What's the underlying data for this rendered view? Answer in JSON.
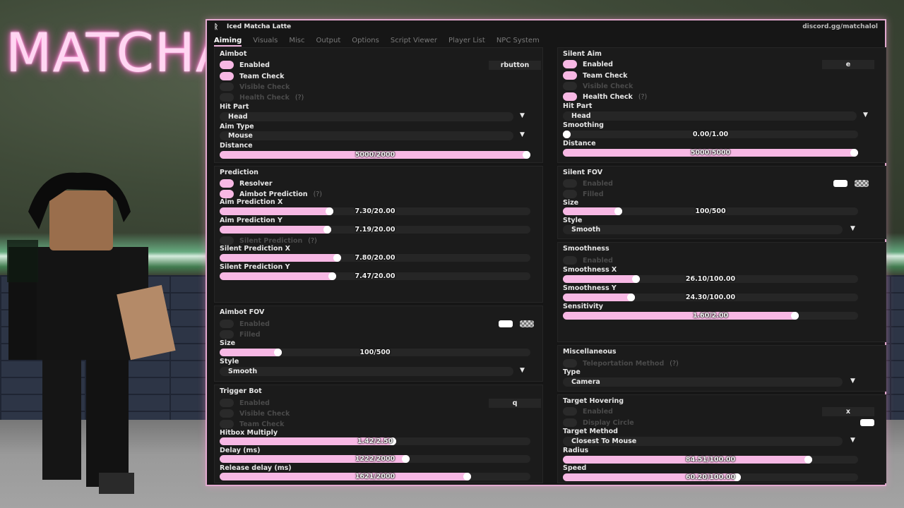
{
  "logo_text": "MATCHA",
  "window": {
    "icon": "matcha-icon",
    "title": "Iced Matcha Latte",
    "discord": "discord.gg/matchalol"
  },
  "tabs": [
    "Aiming",
    "Visuals",
    "Misc",
    "Output",
    "Options",
    "Script Viewer",
    "Player List",
    "NPC System"
  ],
  "active_tab": "Aiming",
  "accent_color": "#f7b8e4",
  "aimbot": {
    "title": "Aimbot",
    "enabled": {
      "label": "Enabled",
      "on": true
    },
    "team_check": {
      "label": "Team Check",
      "on": true
    },
    "visible_check": {
      "label": "Visible Check",
      "on": false
    },
    "health_check": {
      "label": "Health Check",
      "on": false,
      "help": "(?)"
    },
    "keybind": "rbutton",
    "hit_part": {
      "label": "Hit Part",
      "value": "Head"
    },
    "aim_type": {
      "label": "Aim Type",
      "value": "Mouse"
    },
    "distance": {
      "label": "Distance",
      "value": "5000/2000",
      "fraction": 1.0
    }
  },
  "prediction": {
    "title": "Prediction",
    "resolver": {
      "label": "Resolver",
      "on": true
    },
    "aimbot_prediction": {
      "label": "Aimbot Prediction",
      "on": true,
      "help": "(?)"
    },
    "aim_x": {
      "label": "Aim Prediction X",
      "value": "7.30/20.00",
      "fraction": 0.365
    },
    "aim_y": {
      "label": "Aim Prediction Y",
      "value": "7.19/20.00",
      "fraction": 0.36
    },
    "silent_prediction": {
      "label": "Silent Prediction",
      "on": false,
      "help": "(?)"
    },
    "silent_x": {
      "label": "Silent Prediction X",
      "value": "7.80/20.00",
      "fraction": 0.39
    },
    "silent_y": {
      "label": "Silent Prediction Y",
      "value": "7.47/20.00",
      "fraction": 0.374
    }
  },
  "aimbot_fov": {
    "title": "Aimbot FOV",
    "enabled": {
      "label": "Enabled",
      "on": false
    },
    "filled": {
      "label": "Filled",
      "on": false
    },
    "size": {
      "label": "Size",
      "value": "100/500",
      "fraction": 0.2
    },
    "style": {
      "label": "Style",
      "value": "Smooth"
    }
  },
  "trigger_bot": {
    "title": "Trigger Bot",
    "enabled": {
      "label": "Enabled",
      "on": false
    },
    "keybind": "q",
    "visible_check": {
      "label": "Visible Check",
      "on": false
    },
    "team_check": {
      "label": "Team Check",
      "on": false
    },
    "hitbox_multiply": {
      "label": "Hitbox Multiply",
      "value": "1.42/2.50",
      "fraction": 0.568
    },
    "delay": {
      "label": "Delay (ms)",
      "value": "1222/2000",
      "fraction": 0.611
    },
    "release_delay": {
      "label": "Release delay (ms)",
      "value": "1621/2000",
      "fraction": 0.81
    }
  },
  "silent_aim": {
    "title": "Silent Aim",
    "enabled": {
      "label": "Enabled",
      "on": true
    },
    "keybind": "e",
    "team_check": {
      "label": "Team Check",
      "on": true
    },
    "visible_check": {
      "label": "Visible Check",
      "on": false
    },
    "health_check": {
      "label": "Health Check",
      "on": true,
      "help": "(?)"
    },
    "hit_part": {
      "label": "Hit Part",
      "value": "Head"
    },
    "smoothing": {
      "label": "Smoothing",
      "value": "0.00/1.00",
      "fraction": 0.0
    },
    "distance": {
      "label": "Distance",
      "value": "5000/5000",
      "fraction": 1.0
    }
  },
  "silent_fov": {
    "title": "Silent FOV",
    "enabled": {
      "label": "Enabled",
      "on": false
    },
    "filled": {
      "label": "Filled",
      "on": false
    },
    "size": {
      "label": "Size",
      "value": "100/500",
      "fraction": 0.2
    },
    "style": {
      "label": "Style",
      "value": "Smooth"
    }
  },
  "smoothness": {
    "title": "Smoothness",
    "enabled": {
      "label": "Enabled",
      "on": false
    },
    "x": {
      "label": "Smoothness X",
      "value": "26.10/100.00",
      "fraction": 0.261
    },
    "y": {
      "label": "Smoothness Y",
      "value": "24.30/100.00",
      "fraction": 0.243
    },
    "sensitivity": {
      "label": "Sensitivity",
      "value": "1.60/2.00",
      "fraction": 0.8
    }
  },
  "miscellaneous": {
    "title": "Miscellaneous",
    "teleportation": {
      "label": "Teleportation Method",
      "on": false,
      "help": "(?)"
    },
    "type": {
      "label": "Type",
      "value": "Camera"
    }
  },
  "target_hovering": {
    "title": "Target Hovering",
    "enabled": {
      "label": "Enabled",
      "on": false
    },
    "keybind": "x",
    "display_circle": {
      "label": "Display Circle",
      "on": false
    },
    "target_method": {
      "label": "Target Method",
      "value": "Closest To Mouse"
    },
    "radius": {
      "label": "Radius",
      "value": "84.51/100.00",
      "fraction": 0.8451
    },
    "speed": {
      "label": "Speed",
      "value": "60.20/100.00",
      "fraction": 0.602
    }
  }
}
